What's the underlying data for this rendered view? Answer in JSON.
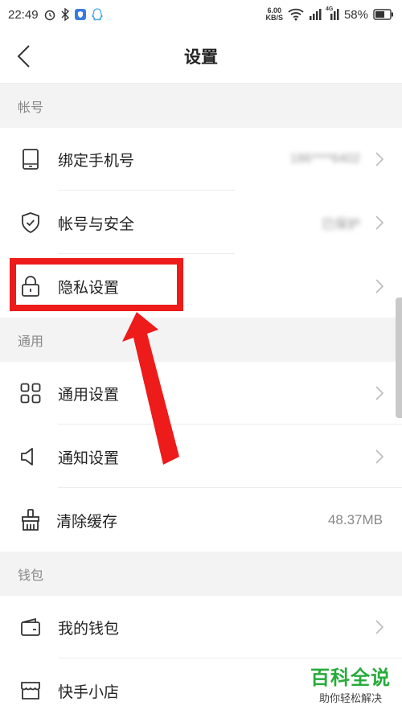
{
  "status_bar": {
    "time": "22:49",
    "net_speed_value": "6.00",
    "net_speed_unit": "KB/S",
    "network_type": "4G",
    "battery": "58%"
  },
  "header": {
    "title": "设置"
  },
  "sections": {
    "account": {
      "title": "帐号",
      "items": [
        {
          "label": "绑定手机号",
          "value": "186****6402",
          "icon": "phone-icon"
        },
        {
          "label": "帐号与安全",
          "value": "已保护",
          "icon": "shield-icon"
        },
        {
          "label": "隐私设置",
          "value": "",
          "icon": "lock-icon"
        }
      ]
    },
    "general": {
      "title": "通用",
      "items": [
        {
          "label": "通用设置",
          "value": "",
          "icon": "grid-icon"
        },
        {
          "label": "通知设置",
          "value": "",
          "icon": "speaker-icon"
        },
        {
          "label": "清除缓存",
          "value": "48.37MB",
          "icon": "broom-icon"
        }
      ]
    },
    "wallet": {
      "title": "钱包",
      "items": [
        {
          "label": "我的钱包",
          "value": "",
          "icon": "wallet-icon"
        },
        {
          "label": "快手小店",
          "value": "",
          "icon": "shop-icon"
        }
      ]
    }
  },
  "watermark": {
    "title": "百科全说",
    "subtitle": "助你轻松解决"
  },
  "colors": {
    "highlight": "#ee1b1b",
    "watermark_green": "#27ab3b",
    "section_bg": "#f3f3f4"
  }
}
